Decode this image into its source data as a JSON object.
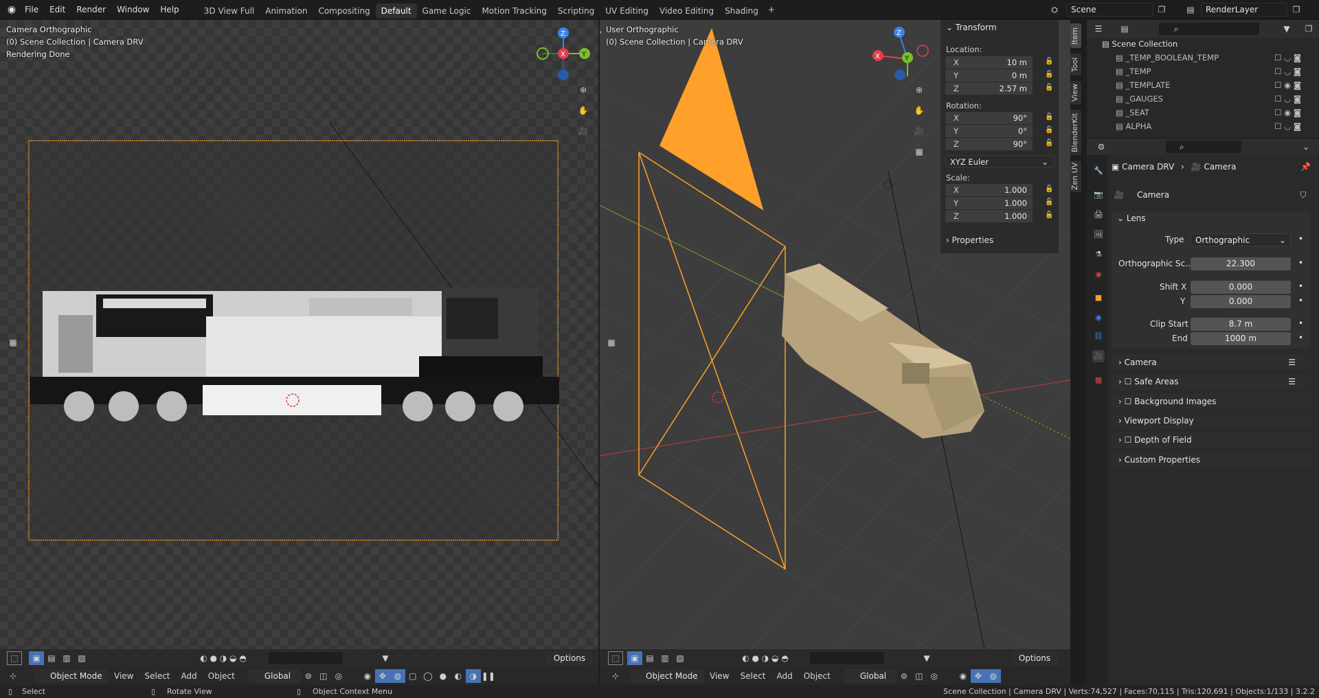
{
  "menu": [
    "File",
    "Edit",
    "Render",
    "Window",
    "Help"
  ],
  "workspaces": [
    "3D View Full",
    "Animation",
    "Compositing",
    "Default",
    "Game Logic",
    "Motion Tracking",
    "Scripting",
    "UV Editing",
    "Video Editing",
    "Shading"
  ],
  "active_workspace": "Default",
  "scene_name": "Scene",
  "render_layer": "RenderLayer",
  "left_view": {
    "title": "Camera Orthographic",
    "collection": "(0) Scene Collection | Camera DRV",
    "status": "Rendering Done",
    "header": {
      "mode": "Object Mode",
      "view": "View",
      "select": "Select",
      "add": "Add",
      "object": "Object",
      "orientation": "Global",
      "options": "Options"
    }
  },
  "right_view": {
    "title": "User Orthographic",
    "collection": "(0) Scene Collection | Camera DRV",
    "header": {
      "mode": "Object Mode",
      "view": "View",
      "select": "Select",
      "add": "Add",
      "object": "Object",
      "orientation": "Global",
      "options": "Options"
    }
  },
  "gizmo": {
    "x": "X",
    "y": "Y",
    "z": "Z"
  },
  "npanel": {
    "title": "Transform",
    "location_label": "Location:",
    "location": [
      {
        "axis": "X",
        "value": "10 m"
      },
      {
        "axis": "Y",
        "value": "0 m"
      },
      {
        "axis": "Z",
        "value": "2.57 m"
      }
    ],
    "rotation_label": "Rotation:",
    "rotation": [
      {
        "axis": "X",
        "value": "90°"
      },
      {
        "axis": "Y",
        "value": "0°"
      },
      {
        "axis": "Z",
        "value": "90°"
      }
    ],
    "rotation_mode": "XYZ Euler",
    "scale_label": "Scale:",
    "scale": [
      {
        "axis": "X",
        "value": "1.000"
      },
      {
        "axis": "Y",
        "value": "1.000"
      },
      {
        "axis": "Z",
        "value": "1.000"
      }
    ],
    "properties": "Properties",
    "tabs": [
      "Item",
      "Tool",
      "View",
      "BlenderKit",
      "Zen UV"
    ]
  },
  "outliner": {
    "root": "Scene Collection",
    "items": [
      "_TEMP_BOOLEAN_TEMP",
      "_TEMP",
      "_TEMPLATE",
      "_GAUGES",
      "_SEAT",
      "ALPHA"
    ]
  },
  "properties": {
    "breadcrumb_object": "Camera DRV",
    "breadcrumb_data": "Camera",
    "datablock": "Camera",
    "lens_section": "Lens",
    "type_label": "Type",
    "type_value": "Orthographic",
    "ortho_label": "Orthographic Sc...",
    "ortho_value": "22.300",
    "shiftx_label": "Shift X",
    "shiftx_value": "0.000",
    "shifty_label": "Y",
    "shifty_value": "0.000",
    "clipstart_label": "Clip Start",
    "clipstart_value": "8.7 m",
    "clipend_label": "End",
    "clipend_value": "1000 m",
    "sections": [
      "Camera",
      "Safe Areas",
      "Background Images",
      "Viewport Display",
      "Depth of Field",
      "Custom Properties"
    ]
  },
  "statusbar": {
    "select": "Select",
    "rotate": "Rotate View",
    "context": "Object Context Menu",
    "info": "Scene Collection | Camera DRV | Verts:74,527 | Faces:70,115 | Tris:120,691 | Objects:1/133 | 3.2.2"
  },
  "colors": {
    "accent": "#4772b3",
    "camera": "#ffa02a",
    "x_axis": "#e0404f",
    "y_axis": "#7bbe2a",
    "z_axis": "#3b84e8"
  }
}
